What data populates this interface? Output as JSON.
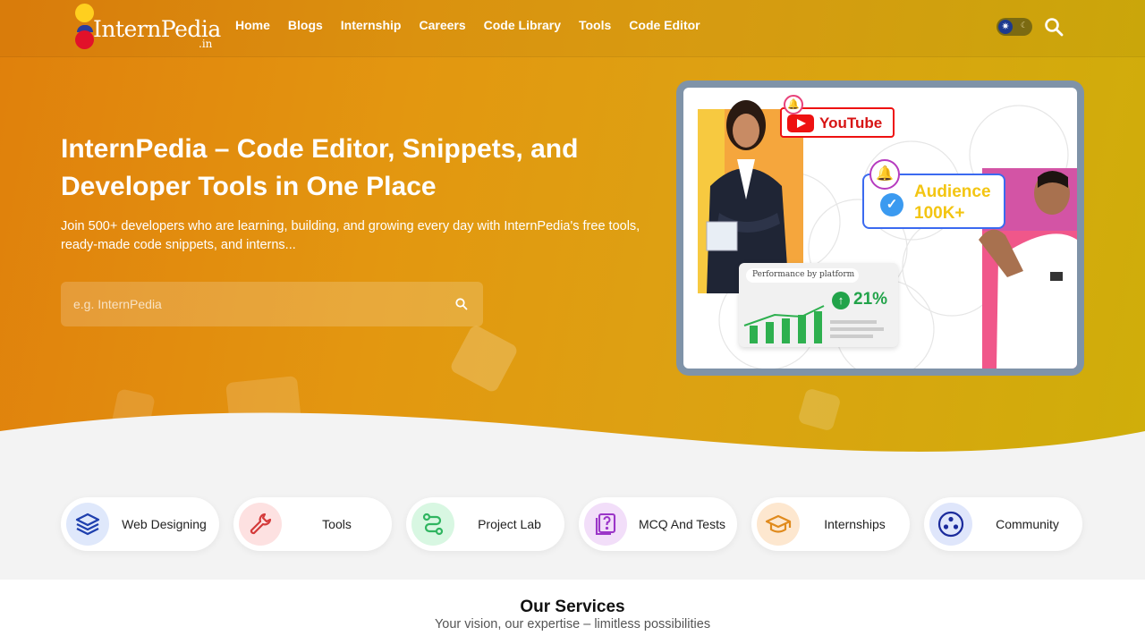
{
  "brand": {
    "name": "InternPedia",
    "suffix": ".in"
  },
  "nav": {
    "items": [
      "Home",
      "Blogs",
      "Internship",
      "Careers",
      "Code Library",
      "Tools",
      "Code Editor"
    ]
  },
  "hero": {
    "title": "InternPedia – Code Editor, Snippets, and Developer Tools in One Place",
    "description": "Join 500+ developers who are learning, building, and growing every day with InternPedia's free tools, ready-made code snippets, and interns...",
    "search_placeholder": "e.g. InternPedia",
    "illustration": {
      "youtube_label": "YouTube",
      "audience_label": "Audience",
      "audience_value": "100K+",
      "performance_label": "Performance by platform",
      "performance_value": "21%"
    }
  },
  "services": [
    {
      "label": "Web Designing",
      "icon": "layers-icon",
      "color": "#1e3fae",
      "bg": "#dfe8fb"
    },
    {
      "label": "Tools",
      "icon": "wrench-icon",
      "color": "#d43a3a",
      "bg": "#fde1e1"
    },
    {
      "label": "Project Lab",
      "icon": "route-icon",
      "color": "#2fb560",
      "bg": "#d8f7e2"
    },
    {
      "label": "MCQ And Tests",
      "icon": "question-file-icon",
      "color": "#9b35c8",
      "bg": "#f2def9"
    },
    {
      "label": "Internships",
      "icon": "graduation-cap-icon",
      "color": "#e08a1c",
      "bg": "#fde7cf"
    },
    {
      "label": "Community",
      "icon": "community-icon",
      "color": "#1b2b9c",
      "bg": "#dfe6fb"
    }
  ],
  "our_services": {
    "title": "Our Services",
    "subtitle": "Your vision, our expertise – limitless possibilities"
  },
  "colors": {
    "hero_start": "#e0800c",
    "hero_end": "#cfae0a",
    "background": "#f3f3f3"
  }
}
